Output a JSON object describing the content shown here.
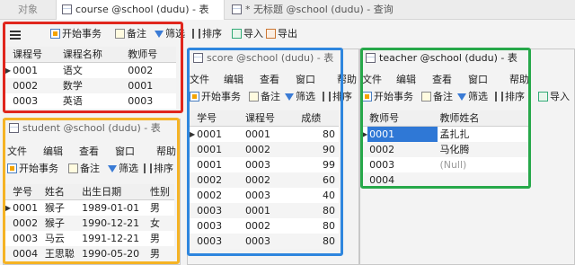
{
  "tabs": [
    {
      "label": "对象"
    },
    {
      "label": "course @school (dudu) - 表"
    },
    {
      "label": "* 无标题 @school (dudu) - 查询"
    }
  ],
  "toolbar": {
    "begin_tx": "开始事务",
    "note": "备注",
    "filter": "筛选",
    "sort": "排序",
    "import": "导入",
    "export": "导出"
  },
  "course": {
    "headers": [
      "课程号",
      "课程名称",
      "教师号"
    ],
    "rows": [
      {
        "cells": [
          "0001",
          "语文",
          "0002"
        ]
      },
      {
        "cells": [
          "0002",
          "数学",
          "0001"
        ]
      },
      {
        "cells": [
          "0003",
          "英语",
          "0003"
        ]
      }
    ]
  },
  "student": {
    "title": "student @school (dudu) - 表",
    "menu": [
      "文件",
      "编辑",
      "查看",
      "窗口",
      "帮助"
    ],
    "toolbar": {
      "begin_tx": "开始事务",
      "note": "备注",
      "filter": "筛选",
      "sort": "排序"
    },
    "headers": [
      "学号",
      "姓名",
      "出生日期",
      "性别"
    ],
    "rows": [
      {
        "cells": [
          "0001",
          "猴子",
          "1989-01-01",
          "男"
        ]
      },
      {
        "cells": [
          "0002",
          "猴子",
          "1990-12-21",
          "女"
        ]
      },
      {
        "cells": [
          "0003",
          "马云",
          "1991-12-21",
          "男"
        ]
      },
      {
        "cells": [
          "0004",
          "王思聪",
          "1990-05-20",
          "男"
        ]
      }
    ]
  },
  "score": {
    "title": "score @school (dudu) - 表",
    "menu": [
      "文件",
      "编辑",
      "查看",
      "窗口",
      "帮助"
    ],
    "toolbar": {
      "begin_tx": "开始事务",
      "note": "备注",
      "filter": "筛选",
      "sort": "排序"
    },
    "headers": [
      "学号",
      "课程号",
      "成绩"
    ],
    "rows": [
      {
        "cells": [
          "0001",
          "0001",
          "80"
        ]
      },
      {
        "cells": [
          "0001",
          "0002",
          "90"
        ]
      },
      {
        "cells": [
          "0001",
          "0003",
          "99"
        ]
      },
      {
        "cells": [
          "0002",
          "0002",
          "60"
        ]
      },
      {
        "cells": [
          "0002",
          "0003",
          "40"
        ]
      },
      {
        "cells": [
          "0003",
          "0001",
          "80"
        ]
      },
      {
        "cells": [
          "0003",
          "0002",
          "80"
        ]
      },
      {
        "cells": [
          "0003",
          "0003",
          "80"
        ]
      }
    ]
  },
  "teacher": {
    "title": "teacher @school (dudu) - 表",
    "menu": [
      "文件",
      "编辑",
      "查看",
      "窗口",
      "帮助"
    ],
    "toolbar": {
      "begin_tx": "开始事务",
      "note": "备注",
      "filter": "筛选",
      "sort": "排序",
      "import": "导入"
    },
    "headers": [
      "教师号",
      "教师姓名"
    ],
    "rows": [
      {
        "cells": [
          "0001",
          "孟扎扎"
        ]
      },
      {
        "cells": [
          "0002",
          "马化腾"
        ]
      },
      {
        "cells": [
          "0003",
          "(Null)"
        ]
      },
      {
        "cells": [
          "0004",
          ""
        ]
      }
    ]
  },
  "colors": {
    "course_frame": "#e0261d",
    "student_frame": "#f5b324",
    "score_frame": "#2e86de",
    "teacher_frame": "#27a84a",
    "selection": "#2f78d6"
  }
}
